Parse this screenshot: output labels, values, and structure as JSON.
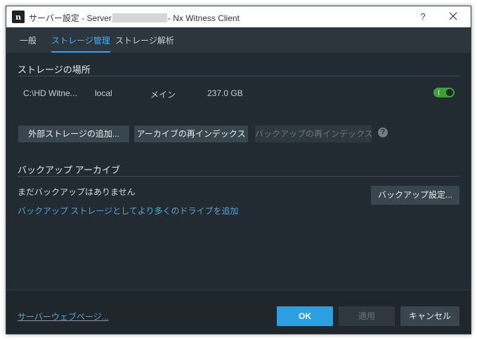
{
  "window": {
    "title_prefix": "サーバー設定 - Server",
    "title_suffix": "- Nx Witness Client",
    "logo_text": "n",
    "help_label": "?"
  },
  "tabs": [
    {
      "label": "一般",
      "active": false
    },
    {
      "label": "ストレージ管理",
      "active": true
    },
    {
      "label": "ストレージ解析",
      "active": false
    }
  ],
  "storage": {
    "section_title": "ストレージの場所",
    "rows": [
      {
        "path": "C:\\HD Witne...",
        "type": "local",
        "role": "メイン",
        "size": "237.0 GB",
        "enabled": true
      }
    ],
    "buttons": {
      "add_external": "外部ストレージの追加...",
      "reindex_archive": "アーカイブの再インデックス",
      "reindex_backup": "バックアップの再インデックス"
    }
  },
  "backup": {
    "section_title": "バックアップ アーカイブ",
    "status": "まだバックアップはありません",
    "add_drive_link": "バックアップ ストレージとしてより多くのドライブを追加",
    "settings_button": "バックアップ設定..."
  },
  "footer": {
    "web_page_link": "サーバーウェブページ...",
    "ok": "OK",
    "apply": "適用",
    "cancel": "キャンセル"
  },
  "colors": {
    "accent": "#2b9fe0",
    "toggle_on": "#3ea036",
    "background": "#222b31"
  }
}
